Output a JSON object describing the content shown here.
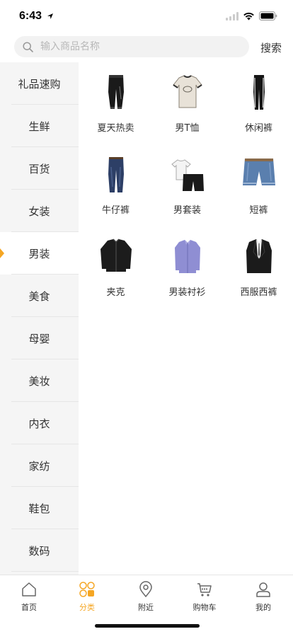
{
  "status_bar": {
    "time": "6:43"
  },
  "search": {
    "placeholder": "输入商品名称",
    "button_label": "搜索"
  },
  "sidebar": {
    "active_index": 4,
    "items": [
      {
        "label": "礼品速购"
      },
      {
        "label": "生鲜"
      },
      {
        "label": "百货"
      },
      {
        "label": "女装"
      },
      {
        "label": "男装"
      },
      {
        "label": "美食"
      },
      {
        "label": "母婴"
      },
      {
        "label": "美妆"
      },
      {
        "label": "内衣"
      },
      {
        "label": "家纺"
      },
      {
        "label": "鞋包"
      },
      {
        "label": "数码"
      }
    ]
  },
  "products": [
    {
      "label": "夏天热卖",
      "icon": "black-joggers-icon"
    },
    {
      "label": "男T恤",
      "icon": "white-tshirt-icon"
    },
    {
      "label": "休闲裤",
      "icon": "track-pants-icon"
    },
    {
      "label": "牛仔裤",
      "icon": "jeans-icon"
    },
    {
      "label": "男套装",
      "icon": "shirt-shorts-set-icon"
    },
    {
      "label": "短裤",
      "icon": "denim-shorts-icon"
    },
    {
      "label": "夹克",
      "icon": "leather-jacket-icon"
    },
    {
      "label": "男装衬衫",
      "icon": "dress-shirt-icon"
    },
    {
      "label": "西服西裤",
      "icon": "suit-icon"
    }
  ],
  "tabbar": {
    "active_index": 1,
    "accent_color": "#f5a623",
    "tabs": [
      {
        "label": "首页",
        "icon": "home-icon"
      },
      {
        "label": "分类",
        "icon": "category-icon"
      },
      {
        "label": "附近",
        "icon": "location-pin-icon"
      },
      {
        "label": "购物车",
        "icon": "cart-icon"
      },
      {
        "label": "我的",
        "icon": "user-icon"
      }
    ]
  }
}
